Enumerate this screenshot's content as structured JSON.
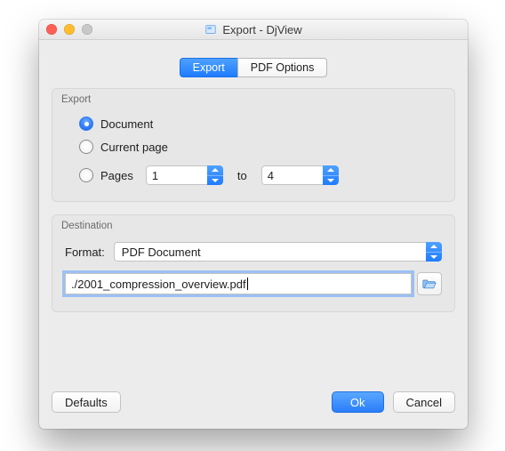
{
  "window": {
    "title": "Export - DjView"
  },
  "tabs": {
    "export": "Export",
    "pdf_options": "PDF Options",
    "active": "export"
  },
  "export": {
    "group_label": "Export",
    "radio_document": "Document",
    "radio_current_page": "Current page",
    "radio_pages": "Pages",
    "selected": "document",
    "from": "1",
    "to_label": "to",
    "to": "4"
  },
  "destination": {
    "group_label": "Destination",
    "format_label": "Format:",
    "format_value": "PDF Document",
    "path": "./2001_compression_overview.pdf"
  },
  "buttons": {
    "defaults": "Defaults",
    "ok": "Ok",
    "cancel": "Cancel"
  },
  "colors": {
    "accent": "#2f7cf6"
  }
}
